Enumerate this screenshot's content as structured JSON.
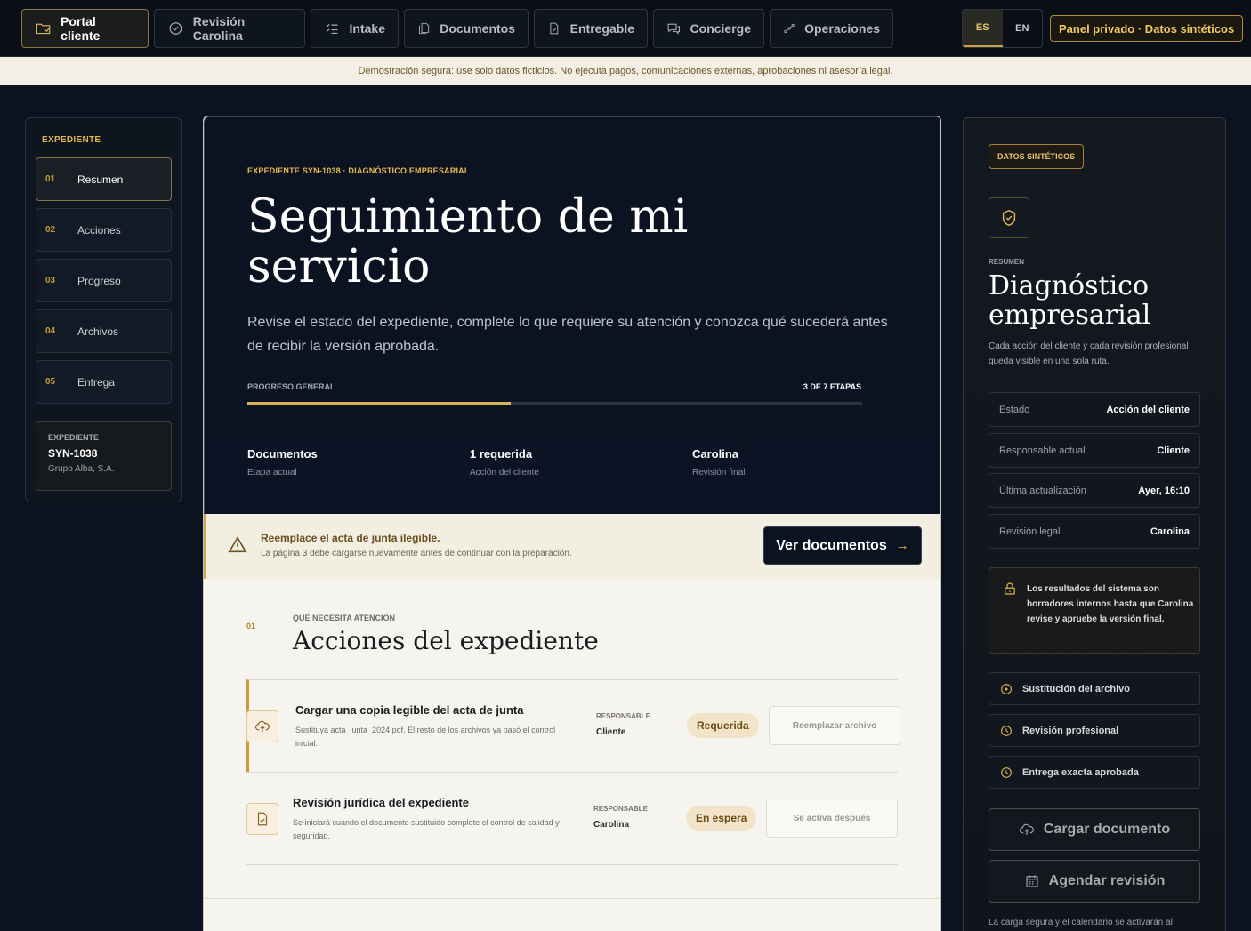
{
  "nav": {
    "tabs": [
      {
        "label": "Portal cliente",
        "icon": "folder-icon",
        "active": true
      },
      {
        "label": "Revisión Carolina",
        "icon": "check-circle-icon",
        "active": false
      },
      {
        "label": "Intake",
        "icon": "list-check-icon",
        "active": false
      },
      {
        "label": "Documentos",
        "icon": "documents-icon",
        "active": false
      },
      {
        "label": "Entregable",
        "icon": "file-check-icon",
        "active": false
      },
      {
        "label": "Concierge",
        "icon": "chat-icon",
        "active": false
      },
      {
        "label": "Operaciones",
        "icon": "workflow-icon",
        "active": false
      }
    ],
    "lang": {
      "es": "ES",
      "en": "EN",
      "selected": "ES"
    },
    "private_badge": "Panel privado · Datos sintéticos"
  },
  "demo_banner": "Demostración segura: use solo datos ficticios. No ejecuta pagos, comunicaciones externas, aprobaciones ni asesoría legal.",
  "sidebar": {
    "title": "EXPEDIENTE",
    "items": [
      {
        "num": "01",
        "label": "Resumen",
        "active": true
      },
      {
        "num": "02",
        "label": "Acciones"
      },
      {
        "num": "03",
        "label": "Progreso"
      },
      {
        "num": "04",
        "label": "Archivos"
      },
      {
        "num": "05",
        "label": "Entrega"
      }
    ],
    "case": {
      "label": "EXPEDIENTE",
      "id": "SYN-1038",
      "company": "Grupo Alba, S.A."
    }
  },
  "hero": {
    "eyebrow": "EXPEDIENTE SYN-1038 · DIAGNÓSTICO EMPRESARIAL",
    "title": "Seguimiento de mi servicio",
    "lead": "Revise el estado del expediente, complete lo que requiere su atención y conozca qué sucederá antes de recibir la versión aprobada.",
    "progress": {
      "label": "PROGRESO GENERAL",
      "value_text": "3 DE 7 ETAPAS",
      "fraction": 0.4286
    },
    "stats": [
      {
        "value": "Documentos",
        "label": "Etapa actual"
      },
      {
        "value": "1 requerida",
        "label": "Acción del cliente"
      },
      {
        "value": "Carolina",
        "label": "Revisión final"
      }
    ]
  },
  "alert": {
    "title": "Reemplace el acta de junta ilegible.",
    "sub": "La página 3 debe cargarse nuevamente antes de continuar con la preparación.",
    "button": "Ver documentos"
  },
  "actions": {
    "num": "01",
    "eyebrow": "QUÉ NECESITA ATENCIÓN",
    "title": "Acciones del expediente",
    "resp_label": "RESPONSABLE",
    "rows": [
      {
        "title": "Cargar una copia legible del acta de junta",
        "desc": "Sustituya acta_junta_2024.pdf. El resto de los archivos ya pasó el control inicial.",
        "owner": "Cliente",
        "status": "Requerida",
        "action": "Reemplazar archivo",
        "icon": "upload-cloud-icon"
      },
      {
        "title": "Revisión jurídica del expediente",
        "desc": "Se iniciará cuando el documento sustituido complete el control de calidad y seguridad.",
        "owner": "Carolina",
        "status": "En espera",
        "action": "Se activa después",
        "icon": "file-check-icon"
      }
    ]
  },
  "right": {
    "badge": "DATOS SINTÉTICOS",
    "eyebrow": "RESUMEN",
    "title": "Diagnóstico empresarial",
    "sub": "Cada acción del cliente y cada revisión profesional queda visible en una sola ruta.",
    "kv": [
      {
        "k": "Estado",
        "v": "Acción del cliente"
      },
      {
        "k": "Responsable actual",
        "v": "Cliente"
      },
      {
        "k": "Última actualización",
        "v": "Ayer, 16:10"
      },
      {
        "k": "Revisión legal",
        "v": "Carolina"
      }
    ],
    "lock_note": "Los resultados del sistema son borradores internos hasta que Carolina revise y apruebe la versión final.",
    "steps": [
      "Sustitución del archivo",
      "Revisión profesional",
      "Entrega exacta aprobada"
    ],
    "buttons": {
      "upload": "Cargar documento",
      "schedule": "Agendar revisión"
    },
    "footer": "La carga segura y el calendario se activarán al"
  },
  "colors": {
    "accent": "#d9b25a",
    "bg": "#0b1320",
    "paper": "#f6f4ef"
  }
}
